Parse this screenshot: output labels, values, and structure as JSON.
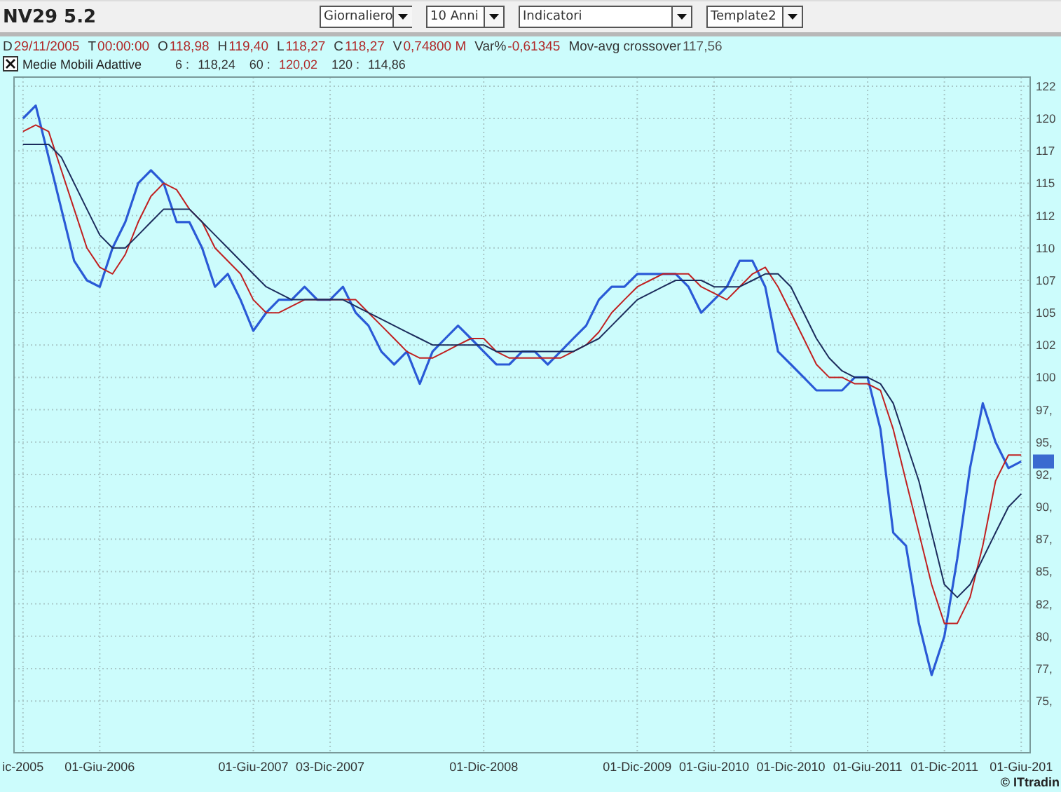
{
  "toolbar": {
    "title": "NV29 5.2",
    "dropdowns": [
      {
        "value": "Giornaliero"
      },
      {
        "value": "10 Anni"
      },
      {
        "value": "Indicatori"
      },
      {
        "value": "Template2"
      }
    ]
  },
  "quote": [
    {
      "label": "D",
      "value": "29/11/2005",
      "color": "#b02828"
    },
    {
      "label": "T",
      "value": "00:00:00",
      "color": "#b02828"
    },
    {
      "label": "O",
      "value": "118,98",
      "color": "#b02828"
    },
    {
      "label": "H",
      "value": "119,40",
      "color": "#b02828"
    },
    {
      "label": "L",
      "value": "118,27",
      "color": "#b02828"
    },
    {
      "label": "C",
      "value": "118,27",
      "color": "#b02828"
    },
    {
      "label": "V",
      "value": "0,74800 M",
      "color": "#b02828"
    },
    {
      "label": "Var%",
      "value": "-0,61345",
      "color": "#b02828"
    },
    {
      "label": "Mov-avg crossover",
      "value": "117,56",
      "color": "#555555"
    }
  ],
  "indicator": {
    "checked": true,
    "name": "Medie Mobili Adattive",
    "separator": ":",
    "values": [
      {
        "value": "118,24",
        "color": "#333333"
      },
      {
        "value": "120,02",
        "color": "#b02828"
      },
      {
        "value": "114,86",
        "color": "#333333"
      }
    ]
  },
  "chart": {
    "chart_data": {
      "type": "line",
      "categories": [
        "ic-2005",
        null,
        null,
        null,
        null,
        null,
        "01-Giu-2006",
        null,
        null,
        null,
        null,
        null,
        null,
        null,
        null,
        null,
        null,
        null,
        "01-Giu-2007",
        null,
        null,
        null,
        null,
        null,
        "03-Dic-2007",
        null,
        null,
        null,
        null,
        null,
        null,
        null,
        null,
        null,
        null,
        null,
        "01-Dic-2008",
        null,
        null,
        null,
        null,
        null,
        null,
        null,
        null,
        null,
        null,
        null,
        "01-Dic-2009",
        null,
        null,
        null,
        null,
        null,
        "01-Giu-2010",
        null,
        null,
        null,
        null,
        null,
        "01-Dic-2010",
        null,
        null,
        null,
        null,
        null,
        "01-Giu-2011",
        null,
        null,
        null,
        null,
        null,
        "01-Dic-2011",
        null,
        null,
        null,
        null,
        null,
        "01-Giu-201"
      ],
      "series": [
        {
          "name": "6",
          "color": "#2a5ad6",
          "values": [
            120,
            121,
            117,
            113,
            109,
            107.5,
            107,
            110,
            112,
            115,
            116,
            115,
            112,
            112,
            110,
            107,
            108,
            106,
            103.6,
            105,
            106,
            106,
            107,
            106,
            106,
            107,
            105,
            104,
            102,
            101,
            102,
            99.5,
            102,
            103,
            104,
            103,
            102,
            101,
            101,
            102,
            102,
            101,
            102,
            103,
            104,
            106,
            107,
            107,
            108,
            108,
            108,
            108,
            107,
            105,
            106,
            107,
            109,
            109,
            107,
            102,
            101,
            100,
            99,
            99,
            99,
            100,
            100,
            96,
            88,
            87,
            81,
            77,
            80,
            86,
            93,
            98,
            95,
            93,
            93.5
          ]
        },
        {
          "name": "60",
          "color": "#c02020",
          "values": [
            119,
            119.5,
            119,
            116,
            113,
            110,
            108.5,
            108,
            109.5,
            112,
            114,
            115,
            114.5,
            113,
            112,
            110,
            109,
            108,
            106,
            105,
            105,
            105.5,
            106,
            106,
            106,
            106,
            106,
            105,
            104,
            103,
            102,
            101.5,
            101.5,
            102,
            102.5,
            103,
            103,
            102,
            101.5,
            101.5,
            101.5,
            101.5,
            101.5,
            102,
            102.5,
            103.5,
            105,
            106,
            107,
            107.5,
            108,
            108,
            108,
            107,
            106.5,
            106,
            107,
            108,
            108.5,
            107,
            105,
            103,
            101,
            100,
            100,
            99.5,
            99.5,
            99,
            96,
            92,
            88,
            84,
            81,
            81,
            83,
            87,
            92,
            94,
            94
          ]
        },
        {
          "name": "120",
          "color": "#1c2c5c",
          "values": [
            118,
            118,
            118,
            117,
            115,
            113,
            111,
            110,
            110,
            111,
            112,
            113,
            113,
            113,
            112,
            111,
            110,
            109,
            108,
            107,
            106.5,
            106,
            106,
            106,
            106,
            106,
            105.5,
            105,
            104.5,
            104,
            103.5,
            103,
            102.5,
            102.5,
            102.5,
            102.5,
            102.5,
            102,
            102,
            102,
            102,
            102,
            102,
            102,
            102.5,
            103,
            104,
            105,
            106,
            106.5,
            107,
            107.5,
            107.5,
            107.5,
            107,
            107,
            107,
            107.5,
            108,
            108,
            107,
            105,
            103,
            101.5,
            100.5,
            100,
            100,
            99.5,
            98,
            95,
            92,
            88,
            84,
            83,
            84,
            86,
            88,
            90,
            91
          ]
        }
      ],
      "ylim": [
        71,
        123.2
      ],
      "grid": true,
      "yticks": [
        {
          "value": 122.5,
          "label": "122"
        },
        {
          "value": 120,
          "label": "120"
        },
        {
          "value": 117.5,
          "label": "117"
        },
        {
          "value": 115,
          "label": "115"
        },
        {
          "value": 112.5,
          "label": "112"
        },
        {
          "value": 110,
          "label": "110"
        },
        {
          "value": 107.5,
          "label": "107"
        },
        {
          "value": 105,
          "label": "105"
        },
        {
          "value": 102.5,
          "label": "102"
        },
        {
          "value": 100,
          "label": "100"
        },
        {
          "value": 97.5,
          "label": "97,"
        },
        {
          "value": 95,
          "label": "95,"
        },
        {
          "value": 92.5,
          "label": "92,"
        },
        {
          "value": 90,
          "label": "90,"
        },
        {
          "value": 87.5,
          "label": "87,"
        },
        {
          "value": 85,
          "label": "85,"
        },
        {
          "value": 82.5,
          "label": "82,"
        },
        {
          "value": 80,
          "label": "80,"
        },
        {
          "value": 77.5,
          "label": "77,"
        },
        {
          "value": 75,
          "label": "75,"
        }
      ]
    },
    "credit": "© ITtradin"
  }
}
